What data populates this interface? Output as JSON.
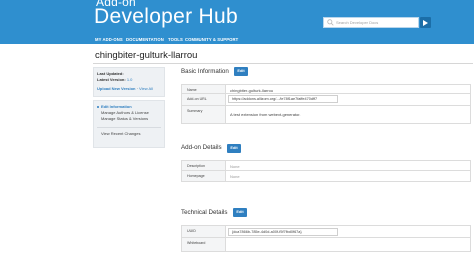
{
  "header": {
    "brand_small": "Add-on",
    "brand_big": "Developer Hub",
    "search_placeholder": "Search Developer Docs"
  },
  "nav": {
    "items": [
      "MY ADD-ONS",
      "DOCUMENTATION",
      "TOOLS",
      "COMMUNITY & SUPPORT"
    ]
  },
  "addon": {
    "title": "chingbiter-gulturk-llarrou"
  },
  "sidebar": {
    "last_updated_label": "Last Updated:",
    "latest_version_label": "Latest Version:",
    "latest_version_value": "1.0",
    "upload_link": "Upload New Version",
    "view_all_link": "View All",
    "menu": [
      "Edit Information",
      "Manage Authors & License",
      "Manage Status & Versions"
    ],
    "view_recent": "View Recent Changes"
  },
  "sections": {
    "basic": {
      "title": "Basic Information",
      "edit": "Edit",
      "rows": [
        {
          "label": "Name",
          "value": "chingbiter-gulturk-llarrou"
        },
        {
          "label": "Add-on URL",
          "value": "https://addons.allizom.org/.../le78f1ae7faffe470dff7"
        },
        {
          "label": "Summary",
          "value": "A test extension from webext-generator."
        }
      ]
    },
    "details": {
      "title": "Add-on Details",
      "edit": "Edit",
      "rows": [
        {
          "label": "Description",
          "value": "None"
        },
        {
          "label": "Homepage",
          "value": "None"
        }
      ]
    },
    "technical": {
      "title": "Technical Details",
      "edit": "Edit",
      "rows": [
        {
          "label": "UUID",
          "value": "{dca7866b-785e-4d0d-a00f-f5f7fbd0f67a}"
        },
        {
          "label": "Whiteboard",
          "value": ""
        }
      ]
    }
  },
  "colors": {
    "header": "#2f8fcf",
    "accent": "#2f7fc0"
  }
}
